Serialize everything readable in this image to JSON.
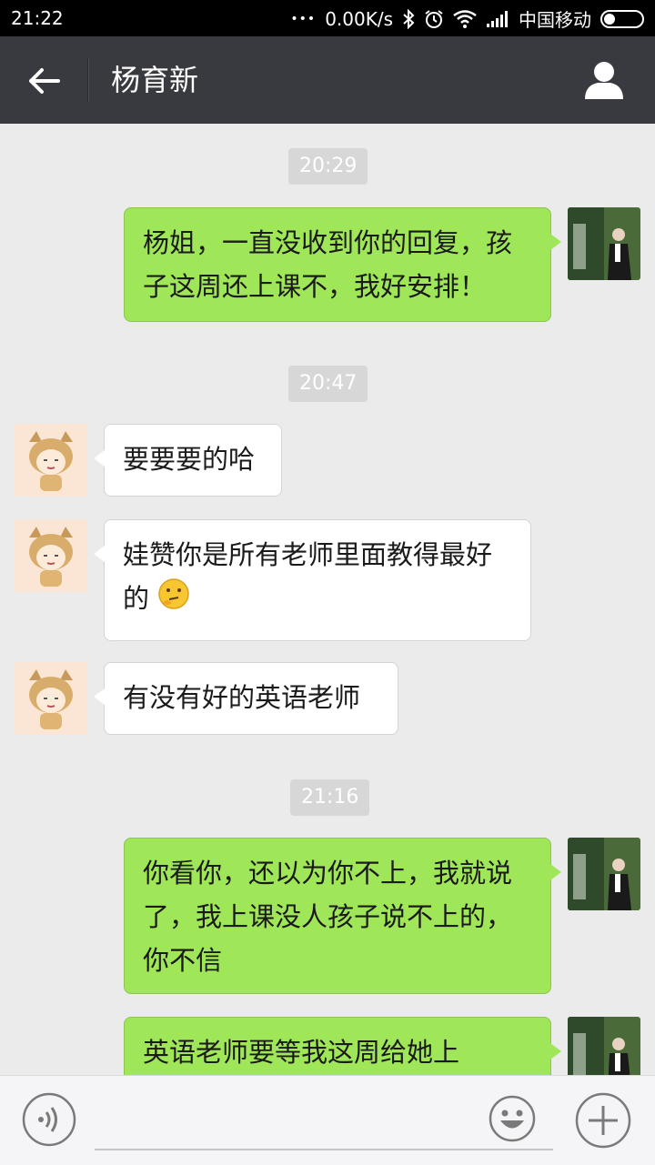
{
  "status_bar": {
    "time": "21:22",
    "dots": "•••",
    "net_speed": "0.00K/s",
    "carrier": "中国移动"
  },
  "header": {
    "title": "杨育新",
    "back_icon": "arrow-left-icon",
    "profile_icon": "person-icon"
  },
  "messages": [
    {
      "type": "timestamp",
      "text": "20:29"
    },
    {
      "type": "message",
      "from": "me",
      "text": "杨姐，一直没收到你的回复，孩子这周还上课不，我好安排！"
    },
    {
      "type": "timestamp",
      "text": "20:47"
    },
    {
      "type": "message",
      "from": "them",
      "text": "要要要的哈"
    },
    {
      "type": "message",
      "from": "them",
      "text": "娃赞你是所有老师里面教得最好的",
      "emoji": "thinking-face-icon"
    },
    {
      "type": "message",
      "from": "them",
      "text": "有没有好的英语老师"
    },
    {
      "type": "timestamp",
      "text": "21:16"
    },
    {
      "type": "message",
      "from": "me",
      "text": "你看你，还以为你不上，我就说了，我上课没人孩子说不上的，你不信"
    },
    {
      "type": "message",
      "from": "me",
      "text": "英语老师要等我这周给她上"
    }
  ],
  "input_bar": {
    "voice_icon": "voice-icon",
    "emoji_icon": "smiley-icon",
    "plus_icon": "plus-icon"
  },
  "colors": {
    "header_bg": "#393a3f",
    "chat_bg": "#ebebeb",
    "my_bubble": "#9fe658",
    "their_bubble": "#ffffff",
    "timestamp_bg": "#d7d7d7"
  }
}
